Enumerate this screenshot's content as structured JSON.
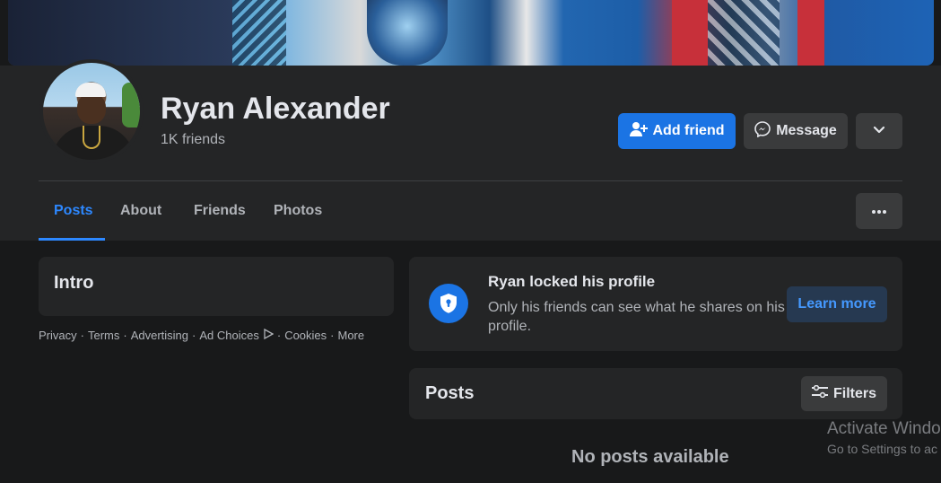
{
  "profile": {
    "name": "Ryan Alexander",
    "friends_count": "1K friends"
  },
  "actions": {
    "add_friend": "Add friend",
    "message": "Message"
  },
  "tabs": [
    {
      "label": "Posts",
      "active": true
    },
    {
      "label": "About",
      "active": false
    },
    {
      "label": "Friends",
      "active": false
    },
    {
      "label": "Photos",
      "active": false
    }
  ],
  "intro": {
    "title": "Intro"
  },
  "footer_links": [
    "Privacy",
    "Terms",
    "Advertising",
    "Ad Choices",
    "Cookies",
    "More"
  ],
  "locked_notice": {
    "title": "Ryan locked his profile",
    "description": "Only his friends can see what he shares on his profile.",
    "learn_more": "Learn more"
  },
  "posts": {
    "title": "Posts",
    "filters": "Filters",
    "empty_message": "No posts available"
  },
  "watermark": {
    "line1": "Activate Windo",
    "line2": "Go to Settings to ac"
  },
  "colors": {
    "accent": "#1b74e4",
    "active_tab": "#2d88ff",
    "background": "#18191a",
    "card": "#242526"
  },
  "icons": [
    "add-friend-icon",
    "messenger-icon",
    "chevron-down-icon",
    "more-dots-icon",
    "shield-lock-icon",
    "filter-icon",
    "ad-choices-icon"
  ]
}
